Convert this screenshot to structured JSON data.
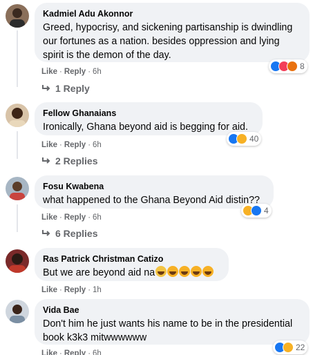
{
  "common": {
    "like": "Like",
    "reply": "Reply",
    "dot": "·"
  },
  "comments": [
    {
      "author": "Kadmiel Adu Akonnor",
      "text": "Greed, hypocrisy, and sickening partisanship is dwindling our fortunes as a nation. besides oppression and lying spirit is the demon of the day.",
      "time": "6h",
      "reaction_count": "8",
      "reactions": [
        "like-icon",
        "love-icon",
        "angry-icon"
      ],
      "replies": "1 Reply"
    },
    {
      "author": "Fellow Ghanaians",
      "text": "Ironically, Ghana beyond aid is begging for aid.",
      "time": "6h",
      "reaction_count": "40",
      "reactions": [
        "like-icon",
        "haha-icon"
      ],
      "replies": "2 Replies"
    },
    {
      "author": "Fosu Kwabena",
      "text": "what happened to the Ghana Beyond Aid distin??",
      "time": "6h",
      "reaction_count": "4",
      "reactions": [
        "haha-icon",
        "like-icon"
      ],
      "replies": "6 Replies"
    },
    {
      "author": "Ras Patrick Christman Catizo",
      "text": "But we are beyond aid na",
      "time": "1h",
      "emojis": [
        "thinking-face-icon",
        "laughing-face-icon",
        "laughing-face-icon",
        "laughing-face-icon",
        "laughing-face-icon"
      ]
    },
    {
      "author": "Vida Bae",
      "text": "Don't him he just wants his name to be in the presidential book k3k3 mitwwwwww",
      "time": "6h",
      "reaction_count": "22",
      "reactions": [
        "like-icon",
        "haha-icon"
      ]
    }
  ],
  "colors": {
    "bubble": "#f0f2f5",
    "meta": "#65676b",
    "like": "#1877f2",
    "love": "#f33e58",
    "haha": "#f7b125",
    "angry": "#e9710f"
  }
}
